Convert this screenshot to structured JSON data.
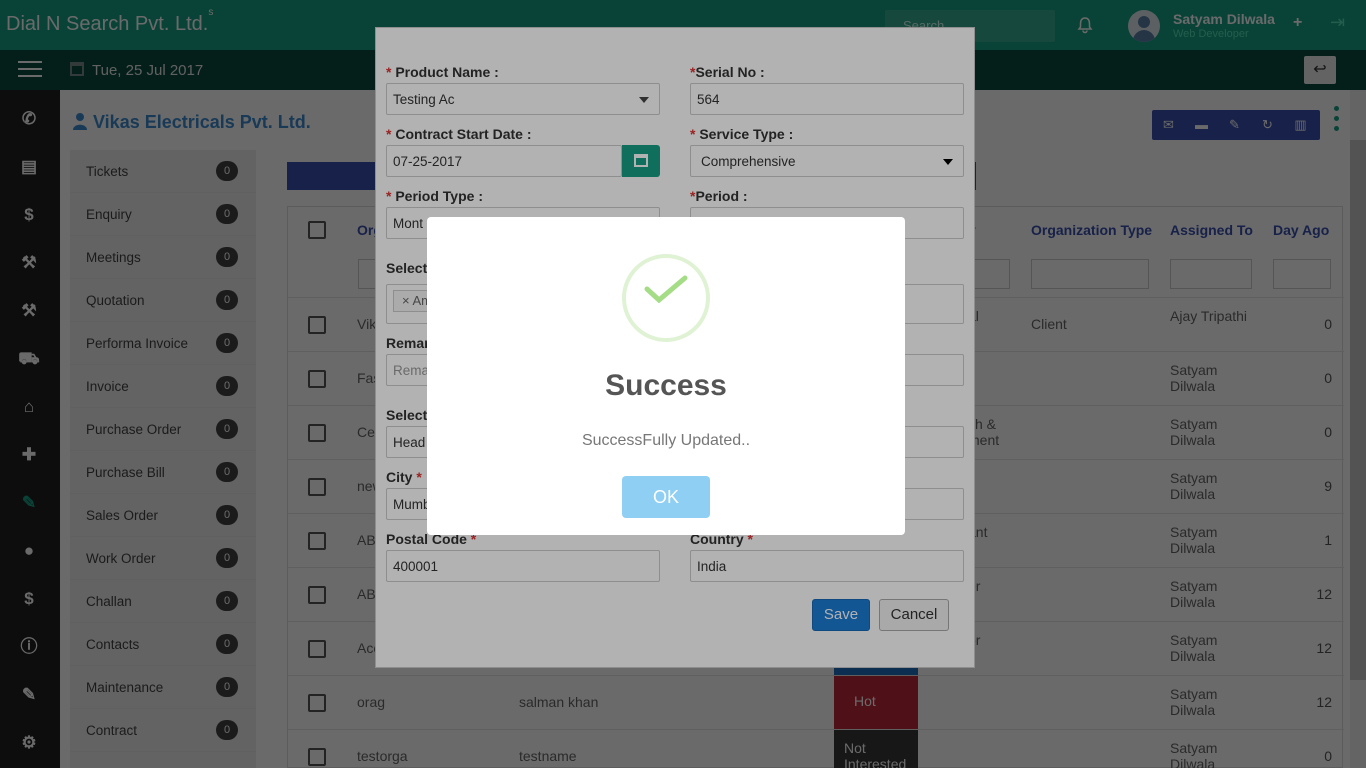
{
  "header": {
    "brand": "Dial N Search Pvt. Ltd.",
    "brand_sup": "s",
    "search_placeholder": "Search",
    "user_name": "Satyam Dilwala",
    "user_role": "Web Developer"
  },
  "subbar": {
    "date": "Tue, 25 Jul 2017"
  },
  "page": {
    "company": "Vikas Electricals Pvt. Ltd.",
    "side_items": [
      {
        "label": "Tickets",
        "count": "0"
      },
      {
        "label": "Enquiry",
        "count": "0"
      },
      {
        "label": "Meetings",
        "count": "0"
      },
      {
        "label": "Quotation",
        "count": "0"
      },
      {
        "label": "Performa Invoice",
        "count": "0"
      },
      {
        "label": "Invoice",
        "count": "0"
      },
      {
        "label": "Purchase Order",
        "count": "0"
      },
      {
        "label": "Purchase Bill",
        "count": "0"
      },
      {
        "label": "Sales Order",
        "count": "0"
      },
      {
        "label": "Work Order",
        "count": "0"
      },
      {
        "label": "Challan",
        "count": "0"
      },
      {
        "label": "Contacts",
        "count": "0"
      },
      {
        "label": "Maintenance",
        "count": "0"
      },
      {
        "label": "Contract",
        "count": "0"
      }
    ],
    "columns": {
      "org": "Org",
      "org_type": "Organization Type",
      "assigned": "Assigned To",
      "day_ago": "Day Ago",
      "partial_y": "y"
    },
    "rows": [
      {
        "org": "Vik\nLtd",
        "name": "",
        "type_partial": "al",
        "org_type": "Client",
        "assigned": "Ajay Tripathi",
        "day": "0",
        "status": "",
        "status_color": ""
      },
      {
        "org": "Fas",
        "name": "",
        "type_partial": "",
        "org_type": "",
        "assigned": "Satyam Dilwala",
        "day": "0",
        "status": "",
        "status_color": ""
      },
      {
        "org": "Cer",
        "name": "",
        "type_partial": "ch &\nment",
        "org_type": "",
        "assigned": "Satyam Dilwala",
        "day": "0",
        "status": "",
        "status_color": ""
      },
      {
        "org": "new",
        "name": "",
        "type_partial": "",
        "org_type": "",
        "assigned": "Satyam Dilwala",
        "day": "9",
        "status": "",
        "status_color": ""
      },
      {
        "org": "AB",
        "name": "",
        "type_partial": "ant",
        "org_type": "",
        "assigned": "Satyam Dilwala",
        "day": "1",
        "status": "",
        "status_color": ""
      },
      {
        "org": "AB",
        "name": "",
        "type_partial": "er",
        "org_type": "",
        "assigned": "Satyam Dilwala",
        "day": "12",
        "status": "",
        "status_color": ""
      },
      {
        "org": "Acc",
        "name": "",
        "type_partial": "or",
        "org_type": "",
        "assigned": "Satyam Dilwala",
        "day": "12",
        "status": "",
        "status_color": "#1b6fc2"
      },
      {
        "org": "orag",
        "name": "salman khan",
        "type_partial": "",
        "org_type": "",
        "assigned": "Satyam Dilwala",
        "day": "12",
        "status": "Hot",
        "status_color": "#c0283a"
      },
      {
        "org": "testorga",
        "name": "testname",
        "type_partial": "",
        "org_type": "",
        "assigned": "Satyam Dilwala",
        "day": "0",
        "status": "Not Interested",
        "status_color": "#3a3a3a"
      }
    ]
  },
  "modal": {
    "product_label": "Product Name :",
    "product_value": "Testing Ac",
    "serial_label": "Serial No :",
    "serial_value": "564",
    "start_label": "Contract Start Date :",
    "start_value": "07-25-2017",
    "service_label": "Service Type :",
    "service_value": "Comprehensive",
    "period_type_label": "Period Type :",
    "period_type_value": "Mont",
    "period_label": "Period :",
    "select_label": "Select",
    "chip_value": "Am",
    "remarks_label": "Remar",
    "remarks_placeholder": "Rema",
    "select2_label": "Select",
    "select2_value": "Head",
    "city_label": "City",
    "city_value": "Mumb",
    "postal_label": "Postal Code",
    "postal_value": "400001",
    "country_label": "Country",
    "country_value": "India",
    "save": "Save",
    "cancel": "Cancel"
  },
  "dialog": {
    "title": "Success",
    "message": "SuccessFully Updated..",
    "ok": "OK"
  },
  "colors": {
    "brand": "#16a085",
    "subbar": "#0d4a3f",
    "primary": "#1b7bd4",
    "ok": "#8ecff3"
  }
}
